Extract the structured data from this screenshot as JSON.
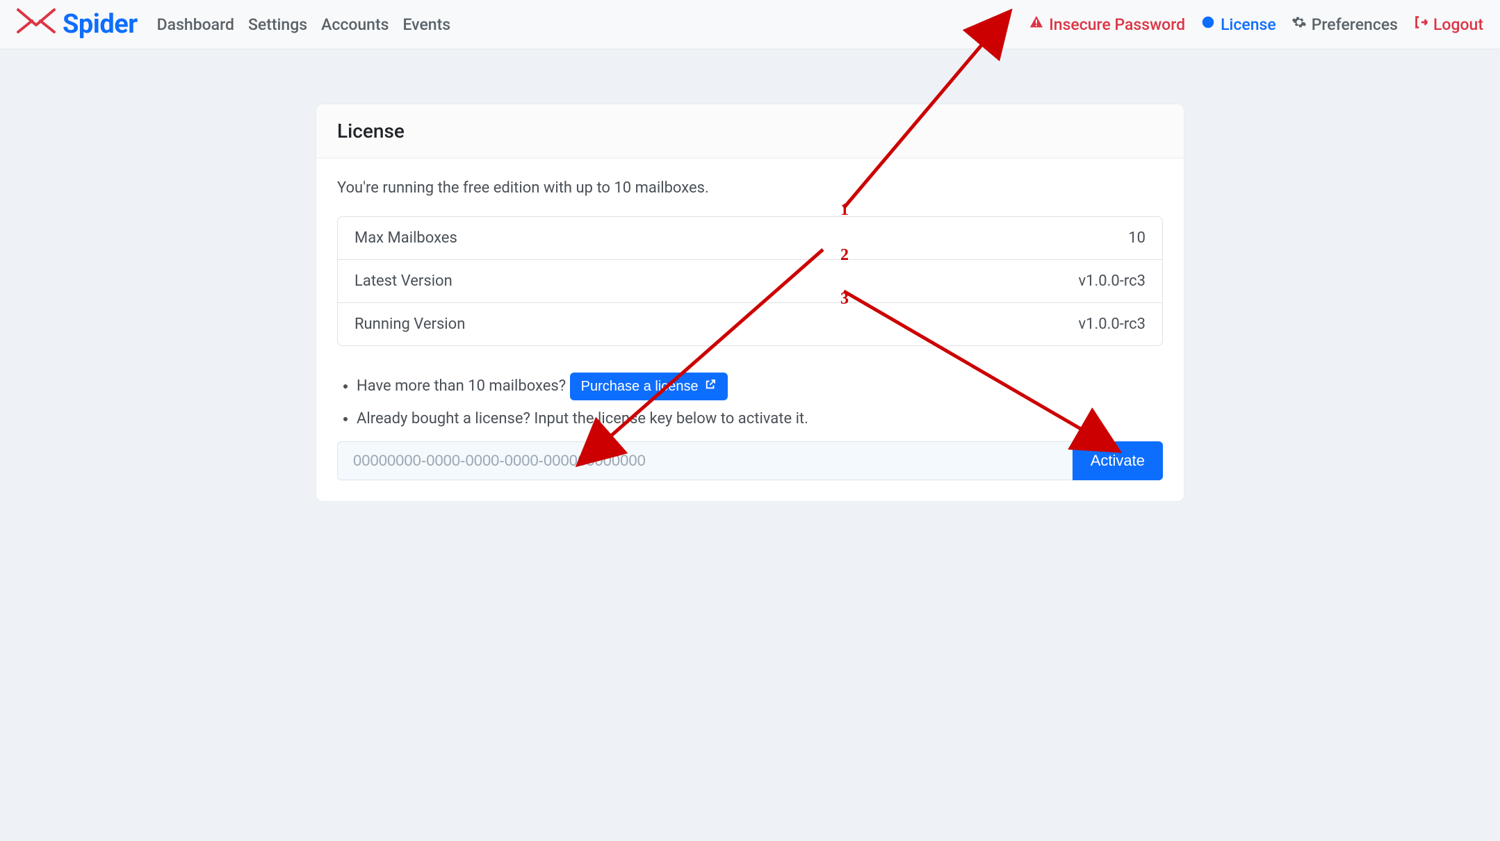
{
  "brand": {
    "name": "Spider"
  },
  "nav": {
    "left": {
      "dashboard": "Dashboard",
      "settings": "Settings",
      "accounts": "Accounts",
      "events": "Events"
    },
    "right": {
      "insecure_password": "Insecure Password",
      "license": "License",
      "preferences": "Preferences",
      "logout": "Logout"
    }
  },
  "card": {
    "title": "License",
    "lead": "You're running the free edition with up to 10 mailboxes.",
    "rows": {
      "max_mailboxes_label": "Max Mailboxes",
      "max_mailboxes_value": "10",
      "latest_version_label": "Latest Version",
      "latest_version_value": "v1.0.0-rc3",
      "running_version_label": "Running Version",
      "running_version_value": "v1.0.0-rc3"
    },
    "bullets": {
      "b1_text": "Have more than 10 mailboxes? ",
      "b1_btn": "Purchase a license",
      "b2_text": "Already bought a license? Input the license key below to activate it."
    },
    "input": {
      "placeholder": "00000000-0000-0000-0000-000000000000",
      "activate": "Activate"
    }
  },
  "annotations": {
    "n1": "1",
    "n2": "2",
    "n3": "3"
  }
}
